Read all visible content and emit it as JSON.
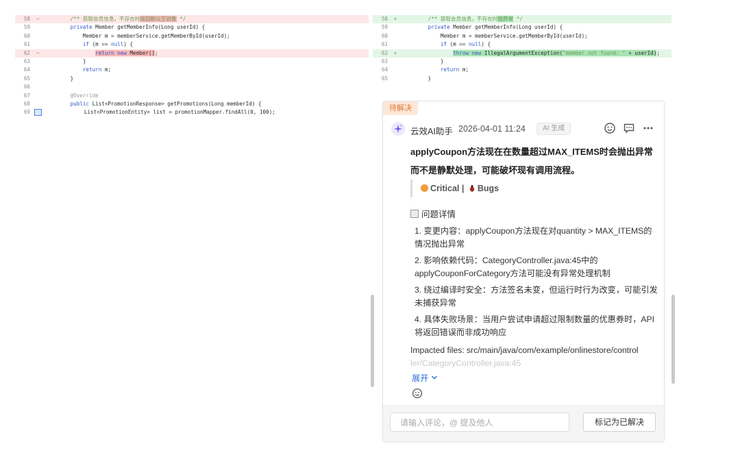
{
  "left_diff": {
    "lines": [
      {
        "ln": "58",
        "mk": "−",
        "type": "del",
        "segments": [
          [
            "cmt",
            "        /** 获取会员信息，不存在时"
          ],
          [
            "cmt hl-del",
            "返回默认空对象"
          ],
          [
            "cmt",
            " */"
          ]
        ]
      },
      {
        "ln": "59",
        "mk": "",
        "type": "ctx",
        "segments": [
          [
            "kw",
            "        private "
          ],
          [
            "",
            "Member getMemberInfo(Long userId) {"
          ]
        ]
      },
      {
        "ln": "60",
        "mk": "",
        "type": "ctx",
        "segments": [
          [
            "",
            "            Member m = memberService.getMemberById(userId);"
          ]
        ]
      },
      {
        "ln": "61",
        "mk": "",
        "type": "ctx",
        "segments": [
          [
            "kw",
            "            if "
          ],
          [
            "",
            "(m == "
          ],
          [
            "kw",
            "null"
          ],
          [
            "",
            ") {"
          ]
        ]
      },
      {
        "ln": "62",
        "mk": "−",
        "type": "del",
        "segments": [
          [
            "",
            "                "
          ],
          [
            "kw hl-del",
            "return new "
          ],
          [
            "hl-del",
            "Member()"
          ],
          [
            "",
            ";"
          ]
        ]
      },
      {
        "ln": "63",
        "mk": "",
        "type": "ctx",
        "segments": [
          [
            "",
            "            }"
          ]
        ]
      },
      {
        "ln": "64",
        "mk": "",
        "type": "ctx",
        "segments": [
          [
            "kw",
            "            return "
          ],
          [
            "",
            "m;"
          ]
        ]
      },
      {
        "ln": "65",
        "mk": "",
        "type": "ctx",
        "segments": [
          [
            "",
            "        }"
          ]
        ]
      },
      {
        "ln": "66",
        "mk": "",
        "type": "ctx",
        "segments": [
          [
            "",
            ""
          ]
        ]
      },
      {
        "ln": "67",
        "mk": "",
        "type": "ctx",
        "segments": [
          [
            "ann",
            "        @Override"
          ]
        ]
      },
      {
        "ln": "68",
        "mk": "",
        "type": "ctx",
        "segments": [
          [
            "kw",
            "        public "
          ],
          [
            "",
            "List<PromotionResponse> getPromotions(Long memberId) {"
          ]
        ]
      },
      {
        "ln": "69",
        "mk": "",
        "type": "ctx",
        "box": true,
        "segments": [
          [
            "",
            "            List<PromotionEntity> list = promotionMapper.findAll(0, 100);"
          ]
        ]
      }
    ]
  },
  "right_diff": {
    "lines": [
      {
        "ln": "58",
        "mk": "+",
        "type": "add",
        "segments": [
          [
            "cmt",
            "        /** 获取会员信息，不存在时"
          ],
          [
            "cmt hl-add",
            "抛异常"
          ],
          [
            "cmt",
            " */"
          ]
        ]
      },
      {
        "ln": "59",
        "mk": "",
        "type": "ctx",
        "segments": [
          [
            "kw",
            "        private "
          ],
          [
            "",
            "Member getMemberInfo(Long userId) {"
          ]
        ]
      },
      {
        "ln": "60",
        "mk": "",
        "type": "ctx",
        "segments": [
          [
            "",
            "            Member m = memberService.getMemberById(userId);"
          ]
        ]
      },
      {
        "ln": "61",
        "mk": "",
        "type": "ctx",
        "segments": [
          [
            "kw",
            "            if "
          ],
          [
            "",
            "(m == "
          ],
          [
            "kw",
            "null"
          ],
          [
            "",
            ") {"
          ]
        ]
      },
      {
        "ln": "62",
        "mk": "+",
        "type": "add",
        "segments": [
          [
            "",
            "                "
          ],
          [
            "kw hl-add",
            "throw new "
          ],
          [
            "hl-add",
            "IllegalArgumentException("
          ],
          [
            "cmt hl-add",
            "\"member not found: \""
          ],
          [
            "hl-add",
            " + userId)"
          ],
          [
            "",
            ";"
          ]
        ]
      },
      {
        "ln": "63",
        "mk": "",
        "type": "ctx",
        "segments": [
          [
            "",
            "            }"
          ]
        ]
      },
      {
        "ln": "64",
        "mk": "",
        "type": "ctx",
        "segments": [
          [
            "kw",
            "            return "
          ],
          [
            "",
            "m;"
          ]
        ]
      },
      {
        "ln": "65",
        "mk": "",
        "type": "ctx",
        "segments": [
          [
            "",
            "        }"
          ]
        ]
      }
    ]
  },
  "comment": {
    "status": "待解决",
    "author": "云效AI助手",
    "time": "2026-04-01 11:24",
    "ai_badge": "AI 生成",
    "title": "applyCoupon方法现在在数量超过MAX_ITEMS时会抛出异常而不是静默处理，可能破坏现有调用流程。",
    "severity": "Critical",
    "separator": "|",
    "category": "Bugs",
    "details_heading": "问题详情",
    "items": [
      "1. 变更内容：applyCoupon方法现在对quantity > MAX_ITEMS的情况抛出异常",
      "2. 影响依赖代码：CategoryController.java:45中的applyCouponForCategory方法可能没有异常处理机制",
      "3. 绕过编译时安全：方法签名未变，但运行时行为改变，可能引发未捕获异常",
      "4. 具体失败场景：当用户尝试申请超过限制数量的优惠券时，API将返回错误而非成功响应"
    ],
    "impacted_label": "Impacted files: src/main/java/com/example/onlinestore/control",
    "impacted_faded": "ler/CategoryController.java:45",
    "expand": "展开",
    "input_placeholder": "请输入评论，@ 提及他人",
    "resolve_button": "标记为已解决"
  },
  "colors": {
    "del_bg": "#fde7e7",
    "add_bg": "#e3f6e6",
    "status_tag": "#e07a3c",
    "severity_dot": "#f39c3d",
    "link": "#2f6fd8"
  }
}
